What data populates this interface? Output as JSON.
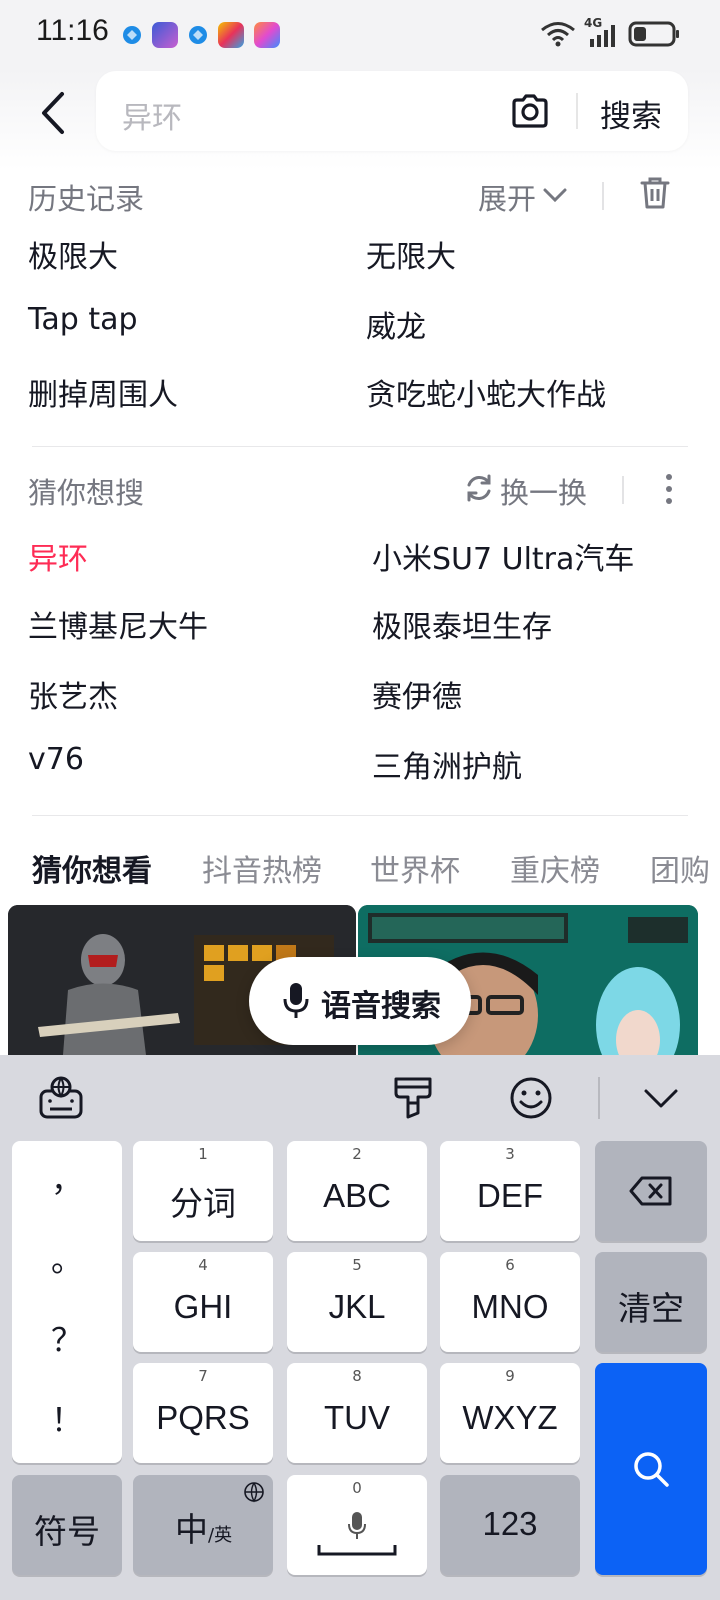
{
  "status_bar": {
    "time": "11:16",
    "network": "4G"
  },
  "search": {
    "placeholder": "异环",
    "button": "搜索"
  },
  "history": {
    "title": "历史记录",
    "expand_label": "展开",
    "items": [
      "极限大",
      "无限大",
      "Tap tap",
      "威龙",
      "删掉周围人",
      "贪吃蛇小蛇大作战"
    ]
  },
  "guess": {
    "title": "猜你想搜",
    "refresh_label": "换一换",
    "items": [
      "异环",
      "小米SU7 Ultra汽车",
      "兰博基尼大牛",
      "极限泰坦生存",
      "张艺杰",
      "赛伊德",
      "v76",
      "三角洲护航"
    ]
  },
  "tabs": [
    "猜你想看",
    "抖音热榜",
    "世界杯",
    "重庆榜",
    "团购"
  ],
  "voice_search": {
    "label": "语音搜索"
  },
  "keyboard": {
    "punctuation": [
      "，",
      "。",
      "？",
      "！"
    ],
    "keys": [
      {
        "num": "1",
        "label": "分词"
      },
      {
        "num": "2",
        "label": "ABC"
      },
      {
        "num": "3",
        "label": "DEF"
      },
      {
        "num": "4",
        "label": "GHI"
      },
      {
        "num": "5",
        "label": "JKL"
      },
      {
        "num": "6",
        "label": "MNO"
      },
      {
        "num": "7",
        "label": "PQRS"
      },
      {
        "num": "8",
        "label": "TUV"
      },
      {
        "num": "9",
        "label": "WXYZ"
      }
    ],
    "clear": "清空",
    "symbols": "符号",
    "lang_main": "中",
    "lang_sub": "/英",
    "space_num": "0",
    "num123": "123"
  },
  "colors": {
    "accent": "#fe2c55",
    "search_key": "#0c62f5",
    "keyboard_bg": "#d8d9df"
  }
}
